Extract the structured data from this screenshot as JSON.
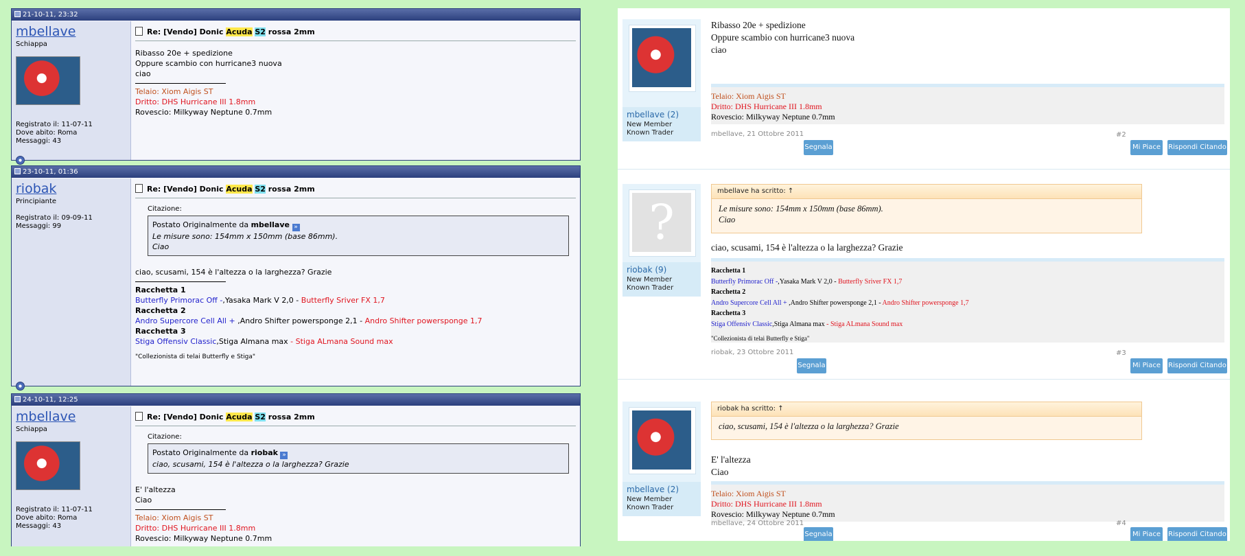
{
  "left": {
    "posts": [
      {
        "date": "21-10-11, 23:32",
        "username": "mbellave",
        "rank": "Schiappa",
        "info": [
          "Registrato il: 11-07-11",
          "Dove abito: Roma",
          "Messaggi: 43"
        ],
        "title_prefix": "Re: [Vendo] Donic ",
        "title_hl1": "Acuda",
        "title_hl2": "S2",
        "title_suffix": " rossa 2mm",
        "lines": [
          "Ribasso 20e + spedizione",
          "Oppure scambio con hurricane3 nuova",
          "ciao"
        ],
        "sig": [
          "Telaio: Xiom Aigis ST",
          "Dritto: DHS Hurricane III 1.8mm",
          "Rovescio: Milkyway Neptune 0.7mm"
        ]
      },
      {
        "date": "23-10-11, 01:36",
        "username": "riobak",
        "rank": "Principiante",
        "info": [
          "Registrato il: 09-09-11",
          "Messaggi: 99"
        ],
        "title_prefix": "Re: [Vendo] Donic ",
        "title_hl1": "Acuda",
        "title_hl2": "S2",
        "title_suffix": " rossa 2mm",
        "quote_label": "Citazione:",
        "quote_by_prefix": "Postato Originalmente da ",
        "quote_by": "mbellave",
        "quote_lines": [
          "Le misure sono: 154mm x 150mm (base 86mm).",
          "Ciao"
        ],
        "lines": [
          "ciao, scusami, 154 è l'altezza o la larghezza? Grazie"
        ],
        "sig": {
          "r1": "Racchetta 1",
          "r1_blue": "Butterfly Primorac Off -",
          "r1_black": ",Yasaka Mark V 2,0 -",
          "r1_red": " Butterfly Sriver FX 1,7",
          "r2": "Racchetta 2",
          "r2_blue": "Andro Supercore Cell All +",
          "r2_black": " ,Andro Shifter powersponge 2,1 -",
          "r2_red": " Andro Shifter powersponge 1,7",
          "r3": "Racchetta 3",
          "r3_blue": "Stiga Offensiv Classic",
          "r3_black": ",Stiga Almana max",
          "r3_red": " - Stiga ALmana Sound max",
          "footer": "\"Collezionista di telai Butterfly e Stiga\""
        }
      },
      {
        "date": "24-10-11, 12:25",
        "username": "mbellave",
        "rank": "Schiappa",
        "info": [
          "Registrato il: 11-07-11",
          "Dove abito: Roma",
          "Messaggi: 43"
        ],
        "title_prefix": "Re: [Vendo] Donic ",
        "title_hl1": "Acuda",
        "title_hl2": "S2",
        "title_suffix": " rossa 2mm",
        "quote_label": "Citazione:",
        "quote_by_prefix": "Postato Originalmente da ",
        "quote_by": "riobak",
        "quote_lines": [
          "ciao, scusami, 154 è l'altezza o la larghezza? Grazie"
        ],
        "lines": [
          "E' l'altezza",
          "Ciao"
        ],
        "sig": [
          "Telaio: Xiom Aigis ST",
          "Dritto: DHS Hurricane III 1.8mm",
          "Rovescio: Milkyway Neptune 0.7mm"
        ]
      }
    ]
  },
  "right": {
    "posts": [
      {
        "username": "mbellave",
        "count": "(2)",
        "roles": [
          "New Member",
          "Known Trader"
        ],
        "lines": [
          "Ribasso 20e + spedizione",
          "Oppure scambio con hurricane3 nuova",
          "ciao"
        ],
        "sig": [
          "Telaio: Xiom Aigis ST",
          "Dritto: DHS Hurricane III 1.8mm",
          "Rovescio: Milkyway Neptune 0.7mm"
        ],
        "meta": "mbellave, 21 Ottobre 2011",
        "num": "#2"
      },
      {
        "username": "riobak",
        "count": "(9)",
        "roles": [
          "New Member",
          "Known Trader"
        ],
        "quote_head": "mbellave ha scritto: ↑",
        "quote_lines": [
          "Le misure sono: 154mm x 150mm (base 86mm).",
          "Ciao"
        ],
        "lines": [
          "ciao, scusami, 154 è l'altezza o la larghezza? Grazie"
        ],
        "sig": {
          "r1": "Racchetta 1",
          "r1_blue": "Butterfly Primorac Off -",
          "r1_black": ",Yasaka Mark V 2,0 -",
          "r1_red": " Butterfly Sriver FX 1,7",
          "r2": "Racchetta 2",
          "r2_blue": "Andro Supercore Cell All +",
          "r2_black": " ,Andro Shifter powersponge 2,1 -",
          "r2_red": " Andro Shifter powersponge 1,7",
          "r3": "Racchetta 3",
          "r3_blue": "Stiga Offensiv Classic",
          "r3_black": ",Stiga Almana max",
          "r3_red": " - Stiga ALmana Sound max",
          "footer": "\"Collezionista di telai Butterfly e Stiga\""
        },
        "meta": "riobak, 23 Ottobre 2011",
        "num": "#3"
      },
      {
        "username": "mbellave",
        "count": "(2)",
        "roles": [
          "New Member",
          "Known Trader"
        ],
        "quote_head": "riobak ha scritto: ↑",
        "quote_lines": [
          "ciao, scusami, 154 è l'altezza o la larghezza? Grazie"
        ],
        "lines": [
          "E' l'altezza",
          "Ciao"
        ],
        "sig": [
          "Telaio: Xiom Aigis ST",
          "Dritto: DHS Hurricane III 1.8mm",
          "Rovescio: Milkyway Neptune 0.7mm"
        ],
        "meta": "mbellave, 24 Ottobre 2011",
        "num": "#4"
      }
    ],
    "buttons": {
      "report": "Segnala",
      "like": "Mi Piace",
      "reply": "Rispondi Citando"
    },
    "blank_avatar": "?"
  },
  "colors": {
    "background": "#c8f5c0",
    "vb_header": "#2b3f7d",
    "xf_button": "#5b9fd3",
    "link": "#2c55b5"
  }
}
